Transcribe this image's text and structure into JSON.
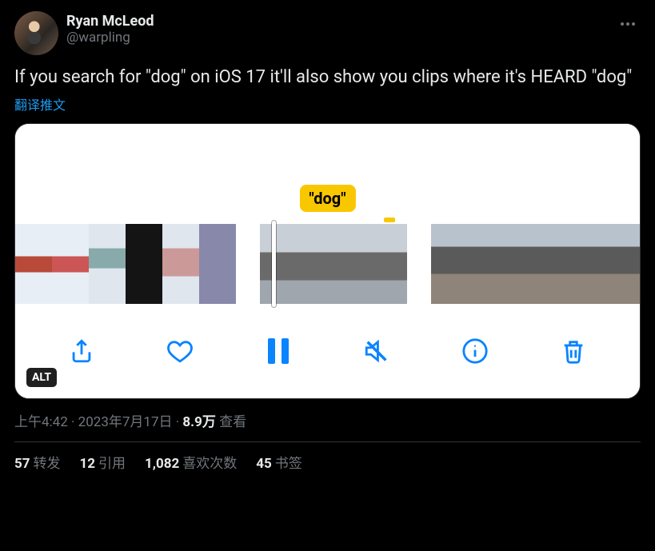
{
  "author": {
    "display_name": "Ryan McLeod",
    "handle": "@warpling"
  },
  "body_text": "If you search for \"dog\" on iOS 17 it'll also show you clips where it's HEARD \"dog\"",
  "translate_label": "翻译推文",
  "media": {
    "caption_label": "\"dog\"",
    "alt_badge": "ALT"
  },
  "meta": {
    "time": "上午4:42",
    "separator": " · ",
    "date": "2023年7月17日",
    "views_count": "8.9万",
    "views_label": " 查看"
  },
  "stats": {
    "retweets": {
      "count": "57",
      "label": "转发"
    },
    "quotes": {
      "count": "12",
      "label": "引用"
    },
    "likes": {
      "count": "1,082",
      "label": "喜欢次数"
    },
    "bookmarks": {
      "count": "45",
      "label": "书签"
    }
  }
}
